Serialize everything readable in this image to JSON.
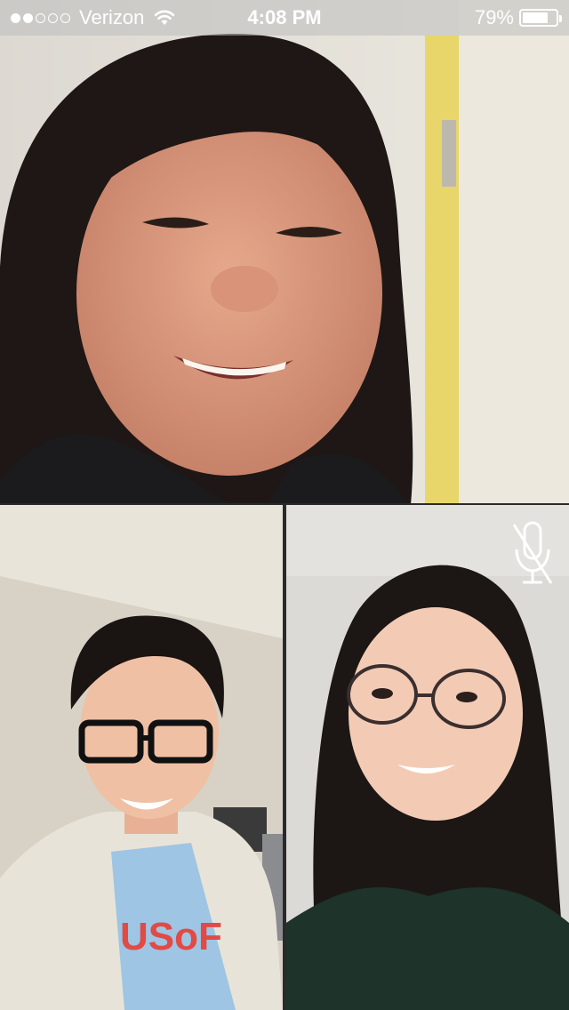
{
  "status_bar": {
    "signal_bars_filled": 2,
    "signal_bars_total": 5,
    "carrier": "Verizon",
    "time": "4:08 PM",
    "battery_percent": "79%",
    "battery_level": 0.79,
    "wifi_icon": "wifi-icon"
  },
  "participants": [
    {
      "position": "top",
      "muted": false
    },
    {
      "position": "bottom-left",
      "muted": false
    },
    {
      "position": "bottom-right",
      "muted": true,
      "mute_icon": "microphone-muted-icon"
    }
  ],
  "colors": {
    "status_bar_text": "#ffffff",
    "wall_yellow": "#e9d86a"
  }
}
